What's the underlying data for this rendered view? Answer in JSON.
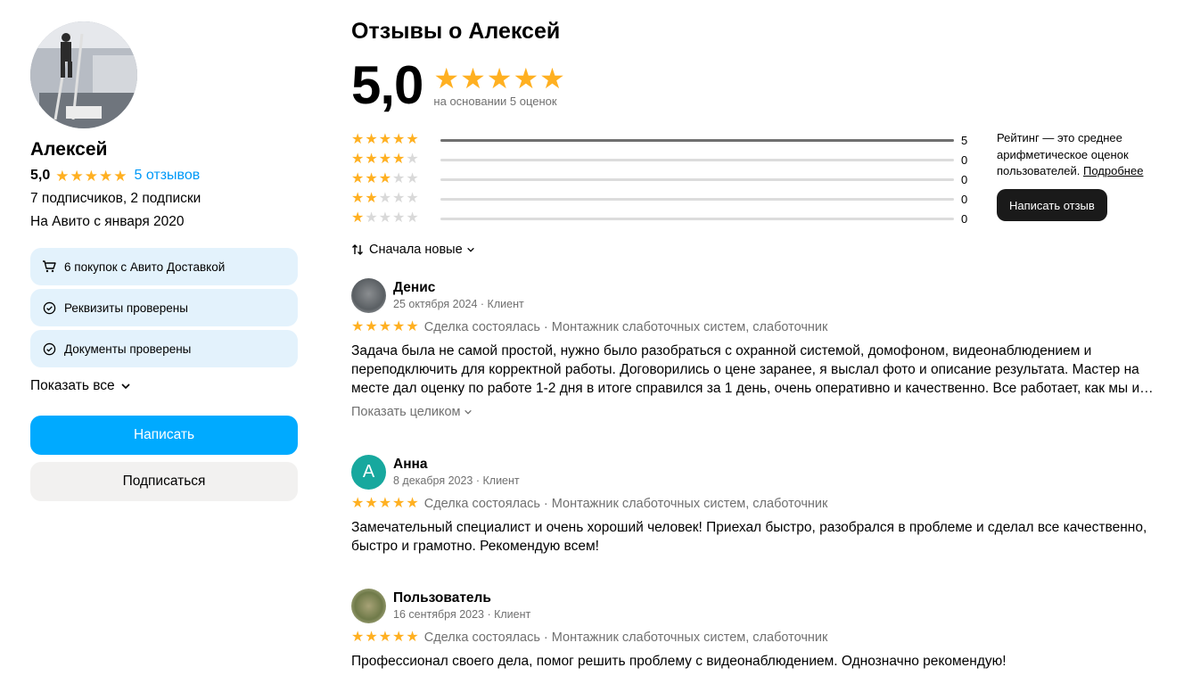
{
  "seller": {
    "name": "Алексей",
    "rating": "5,0",
    "reviews_link": "5 отзывов",
    "followers": "7 подписчиков, 2 подписки",
    "since": "На Авито с января 2020",
    "badges": [
      {
        "icon": "cart-icon",
        "label": "6 покупок с Авито Доставкой"
      },
      {
        "icon": "check-circle-icon",
        "label": "Реквизиты проверены"
      },
      {
        "icon": "check-circle-icon",
        "label": "Документы проверены"
      }
    ],
    "show_all": "Показать все",
    "write_button": "Написать",
    "subscribe_button": "Подписаться"
  },
  "reviews_page": {
    "title": "Отзывы о Алексей",
    "rating": "5,0",
    "basis": "на основании 5 оценок",
    "distribution": [
      {
        "stars": 5,
        "count": "5",
        "fraction": 1.0
      },
      {
        "stars": 4,
        "count": "0",
        "fraction": 0
      },
      {
        "stars": 3,
        "count": "0",
        "fraction": 0
      },
      {
        "stars": 2,
        "count": "0",
        "fraction": 0
      },
      {
        "stars": 1,
        "count": "0",
        "fraction": 0
      }
    ],
    "note_text": "Рейтинг — это среднее арифметическое оценок пользователей.",
    "note_link": "Подробнее",
    "write_review_button": "Написать отзыв",
    "sort_label": "Сначала новые",
    "show_full": "Показать целиком",
    "accent_color": "#ffb021"
  },
  "reviews": [
    {
      "avatar": "photo",
      "name": "Денис",
      "meta": "25 октября 2024 · Клиент",
      "stars": 5,
      "deal": "Сделка состоялась · Монтажник слаботочных систем, слаботочник",
      "text": "Задача была не самой простой, нужно было разобраться с охранной системой, домофоном, видеонаблюдением и переподключить для корректной работы. Договорились о цене заранее, я выслал фото и описание результата. Мастер на месте дал оценку по работе 1-2 дня в итоге справился за 1 день, очень оперативно и качественно. Все работает, как мы и…"
    },
    {
      "avatar_letter": "А",
      "name": "Анна",
      "meta": "8 декабря 2023 · Клиент",
      "stars": 5,
      "deal": "Сделка состоялась · Монтажник слаботочных систем, слаботочник",
      "text": "Замечательный специалист и очень хороший человек! Приехал быстро, разобрался в проблеме и сделал все качественно, быстро и грамотно. Рекомендую всем!"
    },
    {
      "avatar": "photo",
      "name": "Пользователь",
      "meta": "16 сентября 2023 · Клиент",
      "stars": 5,
      "deal": "Сделка состоялась · Монтажник слаботочных систем, слаботочник",
      "text": "Профессионал своего дела, помог решить проблему с видеонаблюдением. Однозначно рекомендую!"
    }
  ]
}
